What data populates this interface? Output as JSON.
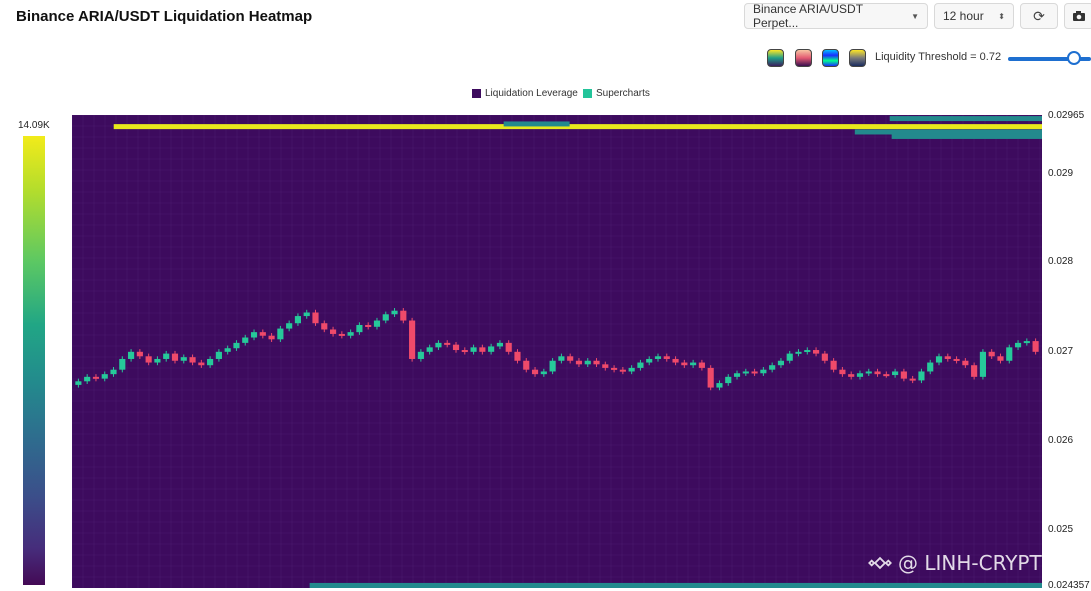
{
  "header": {
    "title": "Binance ARIA/USDT Liquidation Heatmap",
    "pair_select": "Binance ARIA/USDT Perpet...",
    "interval_select": "12 hour",
    "refresh_icon": "refresh-icon",
    "camera_icon": "camera-icon"
  },
  "controls": {
    "swatches": [
      {
        "name": "viridis-swatch",
        "colors": [
          "#1f9e89",
          "#fde725"
        ]
      },
      {
        "name": "magma-swatch",
        "colors": [
          "#e35a72",
          "#f7c6a3"
        ]
      },
      {
        "name": "rainbow-swatch",
        "colors": [
          "#00c3ff",
          "#1a2cff"
        ]
      },
      {
        "name": "cividis-swatch",
        "colors": [
          "#3b4f8a",
          "#fde725"
        ]
      }
    ],
    "threshold_label": "Liquidity Threshold = 0.72",
    "threshold_value": 0.72
  },
  "legend": {
    "items": [
      {
        "label": "Liquidation Leverage",
        "color": "#3d0b5e"
      },
      {
        "label": "Supercharts",
        "color": "#23c49a"
      }
    ]
  },
  "colorbar": {
    "max_label": "14.09K"
  },
  "price_axis": {
    "labels": [
      "0.02965",
      "0.029",
      "0.028",
      "0.027",
      "0.026",
      "0.025",
      "0.024357"
    ]
  },
  "watermark": {
    "text": "@ LINH-CRYPTO"
  },
  "colors": {
    "background": "#3d0b5e",
    "grid": "#4a1a6e",
    "up": "#26c99a",
    "down": "#ef4a6a",
    "yellow_band": "#e8e81c",
    "teal_band": "#238a8d"
  },
  "chart_data": {
    "type": "heatmap",
    "ylim": [
      0.024357,
      0.02965
    ],
    "y_ticks": [
      0.02965,
      0.029,
      0.028,
      0.027,
      0.026,
      0.025,
      0.024357
    ],
    "colorbar_max": 14090,
    "bands": [
      {
        "price": 0.02952,
        "x_start": 0.043,
        "x_end": 1.0,
        "color": "yellow"
      },
      {
        "price": 0.02955,
        "x_start": 0.445,
        "x_end": 0.513,
        "color": "teal"
      },
      {
        "price": 0.02961,
        "x_start": 0.843,
        "x_end": 1.0,
        "color": "teal"
      },
      {
        "price": 0.02946,
        "x_start": 0.807,
        "x_end": 1.0,
        "color": "teal"
      },
      {
        "price": 0.02941,
        "x_start": 0.845,
        "x_end": 1.0,
        "color": "teal"
      },
      {
        "price": 0.02438,
        "x_start": 0.245,
        "x_end": 1.0,
        "color": "teal"
      }
    ],
    "candles_close": [
      0.02667,
      0.02672,
      0.0267,
      0.02675,
      0.0268,
      0.02692,
      0.027,
      0.02695,
      0.02688,
      0.02692,
      0.02698,
      0.0269,
      0.02694,
      0.02688,
      0.02685,
      0.02692,
      0.027,
      0.02704,
      0.0271,
      0.02716,
      0.02722,
      0.02718,
      0.02714,
      0.02726,
      0.02732,
      0.0274,
      0.02744,
      0.02732,
      0.02725,
      0.0272,
      0.02718,
      0.02722,
      0.0273,
      0.02728,
      0.02735,
      0.02742,
      0.02746,
      0.02735,
      0.02692,
      0.027,
      0.02705,
      0.0271,
      0.02708,
      0.02702,
      0.027,
      0.02705,
      0.027,
      0.02706,
      0.0271,
      0.027,
      0.0269,
      0.0268,
      0.02675,
      0.02678,
      0.0269,
      0.02695,
      0.0269,
      0.02686,
      0.0269,
      0.02686,
      0.02682,
      0.0268,
      0.02678,
      0.02682,
      0.02688,
      0.02692,
      0.02695,
      0.02692,
      0.02688,
      0.02685,
      0.02688,
      0.02682,
      0.0266,
      0.02665,
      0.02672,
      0.02676,
      0.02678,
      0.02676,
      0.0268,
      0.02685,
      0.0269,
      0.02698,
      0.027,
      0.02702,
      0.02698,
      0.0269,
      0.0268,
      0.02675,
      0.02672,
      0.02676,
      0.02678,
      0.02675,
      0.02674,
      0.02678,
      0.0267,
      0.02668,
      0.02678,
      0.02688,
      0.02695,
      0.02692,
      0.0269,
      0.02685,
      0.02672,
      0.027,
      0.02695,
      0.0269,
      0.02705,
      0.0271,
      0.02712,
      0.027
    ]
  }
}
